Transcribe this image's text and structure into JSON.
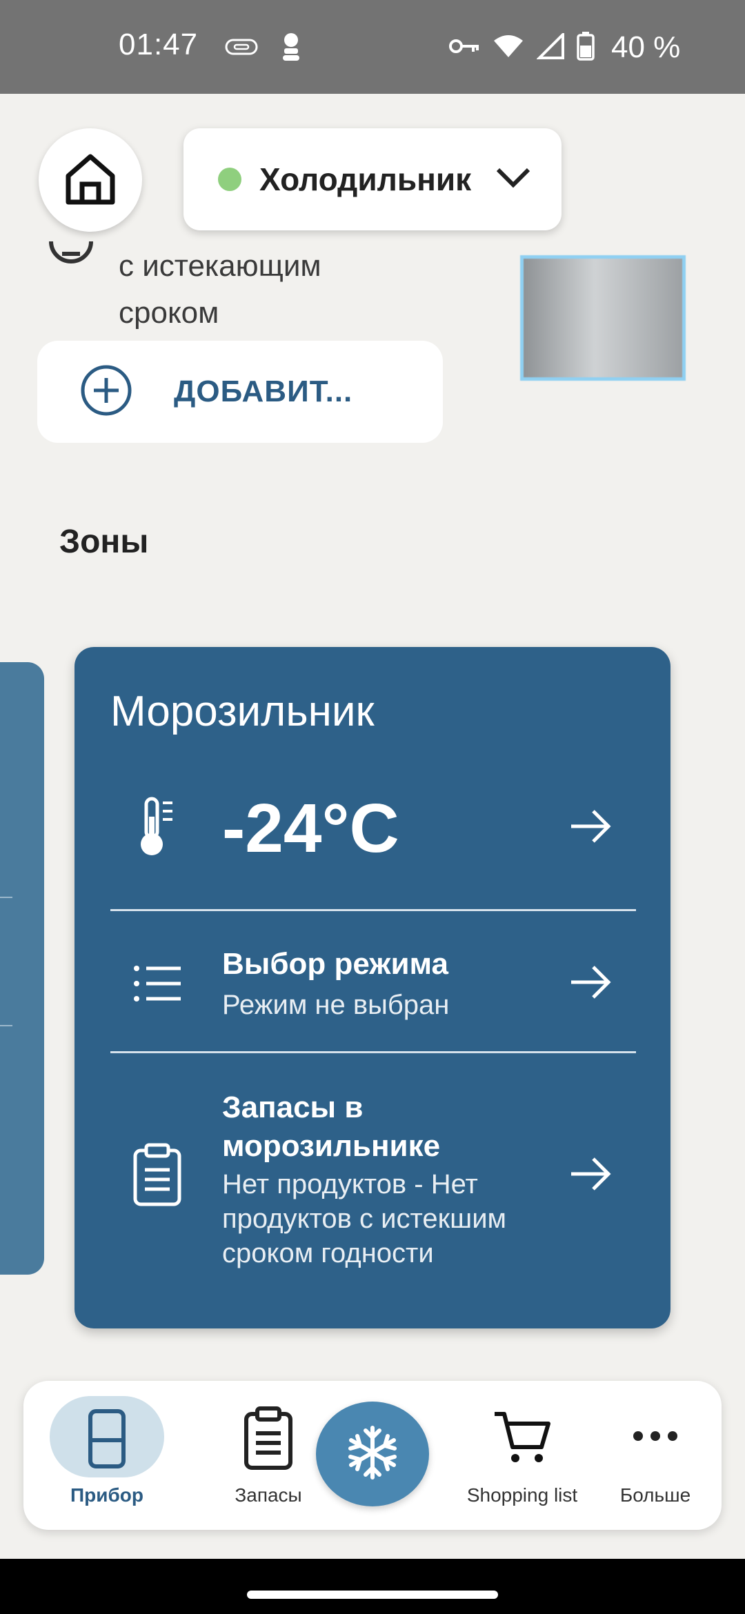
{
  "status_bar": {
    "time": "01:47",
    "battery": "40 %",
    "icons": [
      "link-icon",
      "android-icon",
      "vpn-key-icon",
      "wifi-icon",
      "signal-icon",
      "battery-icon"
    ]
  },
  "header": {
    "device_name": "Холодильник",
    "device_status_color": "#8fcf7e"
  },
  "scrolled_content": {
    "expiring_text": "с истекающим сроком",
    "add_button_label": "ДОБАВИТ..."
  },
  "zones": {
    "title": "Зоны",
    "card": {
      "name": "Морозильник",
      "temperature": "-24°C",
      "mode_title": "Выбор режима",
      "mode_subtitle": "Режим не выбран",
      "stock_title": "Запасы в морозильнике",
      "stock_subtitle": "Нет продуктов - Нет продуктов с истекшим сроком годности"
    }
  },
  "bottom_nav": {
    "items": [
      {
        "label": "Прибор",
        "icon": "fridge-icon",
        "active": true
      },
      {
        "label": "Запасы",
        "icon": "clipboard-icon",
        "active": false
      },
      {
        "label": "",
        "icon": "snowflake-icon",
        "active": false
      },
      {
        "label": "Shopping list",
        "icon": "cart-icon",
        "active": false
      },
      {
        "label": "Больше",
        "icon": "more-icon",
        "active": false
      }
    ]
  },
  "colors": {
    "card": "#2e6189",
    "accent": "#2b5b83",
    "fab": "#4a87b1",
    "background": "#f2f1ee"
  }
}
